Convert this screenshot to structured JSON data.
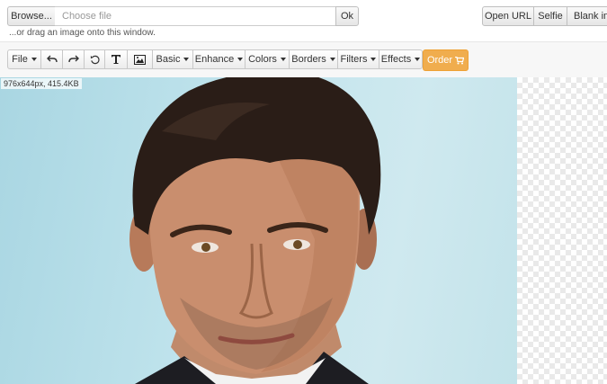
{
  "top": {
    "browse_label": "Browse...",
    "file_placeholder": "Choose file",
    "ok_label": "Ok",
    "drag_hint": "...or drag an image onto this window.",
    "open_url_label": "Open URL",
    "selfie_label": "Selfie",
    "blank_label": "Blank ima"
  },
  "toolbar": {
    "file_label": "File",
    "basic_label": "Basic",
    "enhance_label": "Enhance",
    "colors_label": "Colors",
    "borders_label": "Borders",
    "filters_label": "Filters",
    "effects_label": "Effects",
    "order_label": "Order",
    "icons": [
      "undo-icon",
      "redo-icon",
      "reset-icon",
      "text-icon",
      "image-icon",
      "cart-icon"
    ]
  },
  "canvas": {
    "image_info": "976x644px, 415.4KB"
  },
  "colors": {
    "accent": "#f0ad4e",
    "background_sky": "#bfe3ec"
  }
}
